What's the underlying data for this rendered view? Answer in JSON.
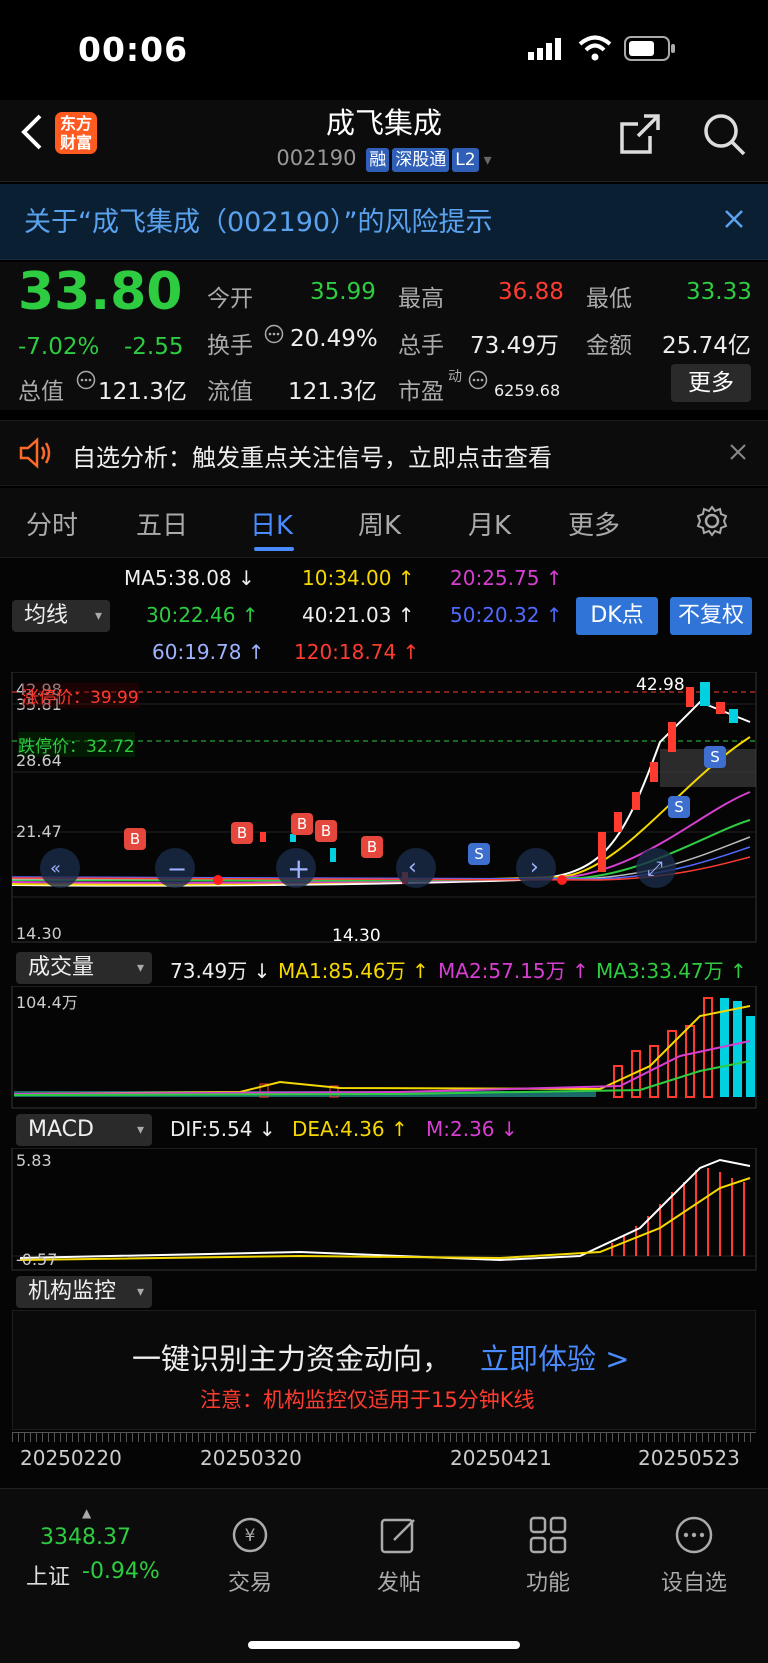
{
  "status": {
    "time": "00:06"
  },
  "header": {
    "logo_line1": "东方",
    "logo_line2": "财富",
    "title": "成飞集成",
    "code": "002190",
    "tags": [
      "融",
      "深股通",
      "L2"
    ]
  },
  "alert": {
    "text": "关于“成飞集成（002190）”的风险提示"
  },
  "quote": {
    "price": "33.80",
    "pct": "-7.02%",
    "change": "-2.55",
    "open_label": "今开",
    "open": "35.99",
    "high_label": "最高",
    "high": "36.88",
    "low_label": "最低",
    "low": "33.33",
    "turnover_label": "换手",
    "turnover": "20.49%",
    "volume_label": "总手",
    "volume": "73.49万",
    "amount_label": "金额",
    "amount": "25.74亿",
    "mcap_label": "总值",
    "mcap": "121.3亿",
    "float_label": "流值",
    "float": "121.3亿",
    "pe_label": "市盈",
    "pe_sup": "动",
    "pe": "6259.68",
    "more": "更多"
  },
  "notice": {
    "text": "自选分析：触发重点关注信号，立即点击查看"
  },
  "tabs": [
    "分时",
    "五日",
    "日K",
    "周K",
    "月K",
    "更多"
  ],
  "ma": {
    "dropdown": "均线",
    "ma5": "MA5:38.08",
    "ma10": "10:34.00",
    "ma20": "20:25.75",
    "ma30": "30:22.46",
    "ma40": "40:21.03",
    "ma50": "50:20.32",
    "ma60": "60:19.78",
    "ma120": "120:18.74",
    "dk": "DK点",
    "fq": "不复权"
  },
  "kline": {
    "limit_up": "涨停价：39.99",
    "limit_down": "跌停价：32.72",
    "y_labels": [
      "42.98",
      "35.81",
      "28.64",
      "21.47",
      "14.30"
    ],
    "high_mark": "42.98",
    "low_mark": "14.30"
  },
  "volume": {
    "dropdown": "成交量",
    "value": "73.49万",
    "ma1": "MA1:85.46万",
    "ma2": "MA2:57.15万",
    "ma3": "MA3:33.47万",
    "y_label": "104.4万"
  },
  "macd": {
    "dropdown": "MACD",
    "dif": "DIF:5.54",
    "dea": "DEA:4.36",
    "m": "M:2.36",
    "y_top": "5.83",
    "y_bottom": "-0.57"
  },
  "institution": {
    "dropdown": "机构监控",
    "headline": "一键识别主力资金动向，",
    "cta": "立即体验 >",
    "note": "注意：机构监控仅适用于15分钟K线"
  },
  "dates": [
    "20250220",
    "20250320",
    "20250421",
    "20250523"
  ],
  "bottom": {
    "index_value": "3348.37",
    "index_name": "上证",
    "index_pct": "-0.94%",
    "items": [
      "交易",
      "发帖",
      "功能",
      "设自选"
    ]
  }
}
